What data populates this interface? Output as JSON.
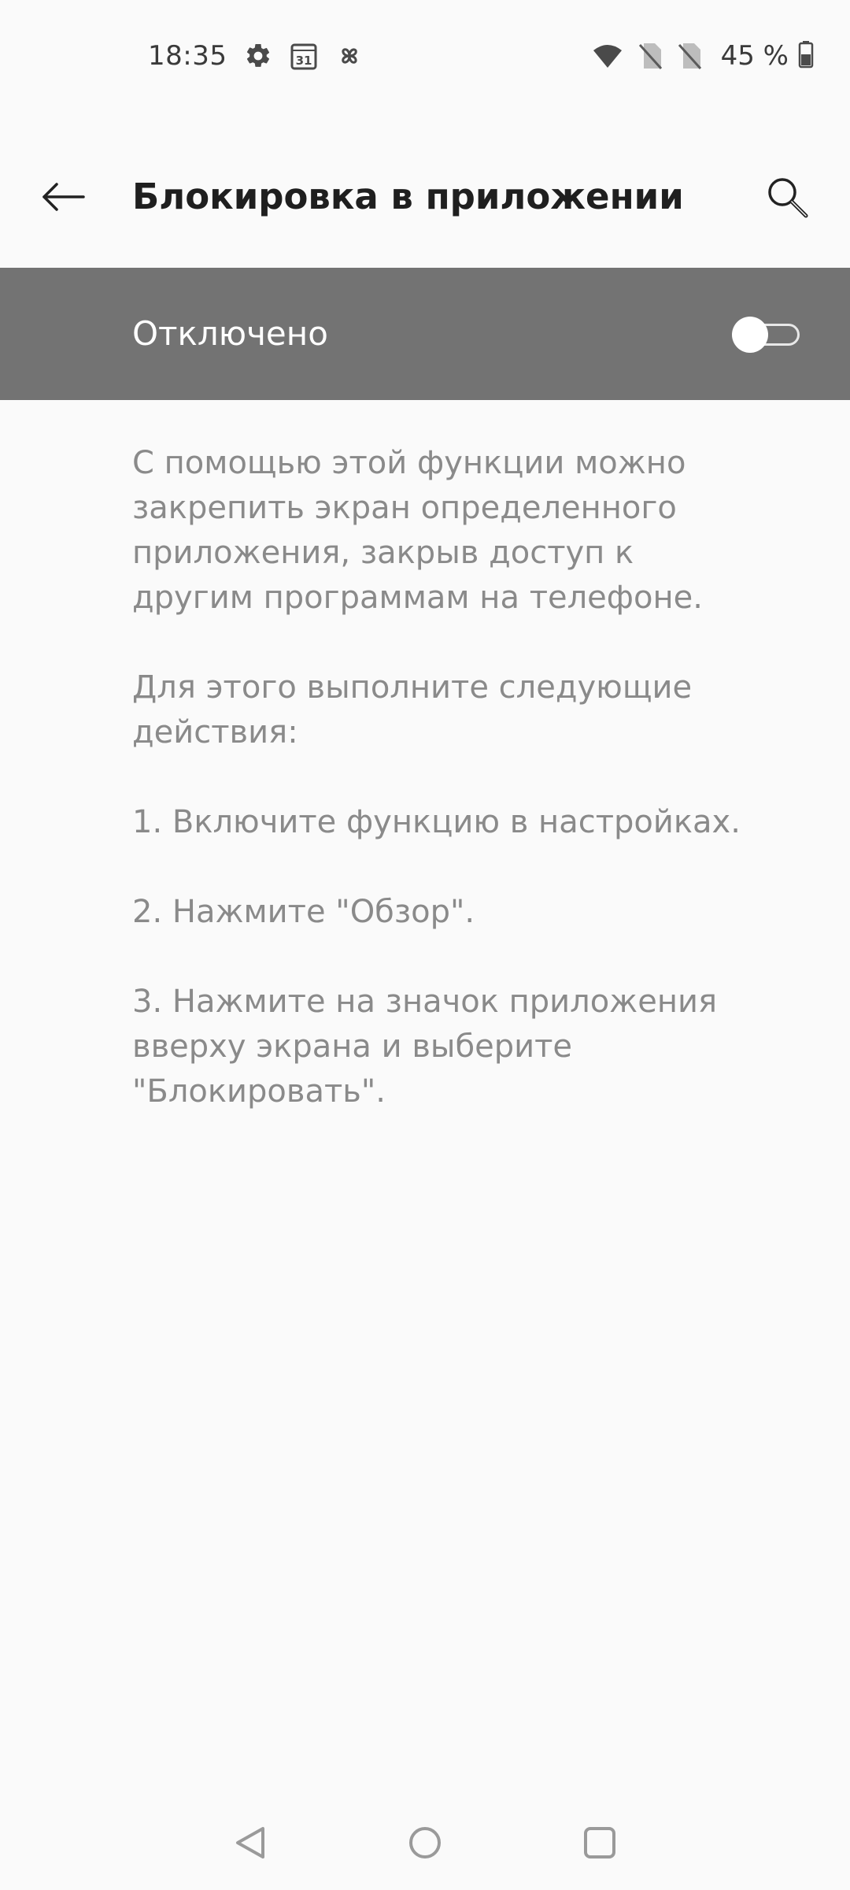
{
  "status_bar": {
    "time": "18:35",
    "left_icons": [
      "settings-gear-icon",
      "calendar-31-icon",
      "pinwheel-icon"
    ],
    "calendar_day": "31",
    "right_icons": [
      "wifi-icon",
      "no-sim-icon",
      "no-sim-icon",
      "battery-icon"
    ],
    "battery_text": "45 %"
  },
  "app_bar": {
    "title": "Блокировка в приложении",
    "back_icon": "arrow-left-icon",
    "search_icon": "search-icon"
  },
  "master_switch": {
    "label": "Отключено",
    "state": "off"
  },
  "description": {
    "paragraphs": [
      "С помощью этой функции можно закрепить экран определенного приложения, закрыв доступ к другим программам на телефоне.",
      "Для этого выполните следующие действия:",
      "1. Включите функцию в настройках.",
      "2. Нажмите \"Обзор\".",
      "3. Нажмите на значок приложения вверху экрана и выберите \"Блокировать\"."
    ]
  },
  "nav_bar": {
    "icons": [
      "nav-back-triangle-icon",
      "nav-home-circle-icon",
      "nav-recents-square-icon"
    ]
  },
  "colors": {
    "background": "#fafafa",
    "switch_bar": "#737373",
    "title_text": "#1f1f1f",
    "body_text": "#8a8a8a"
  }
}
